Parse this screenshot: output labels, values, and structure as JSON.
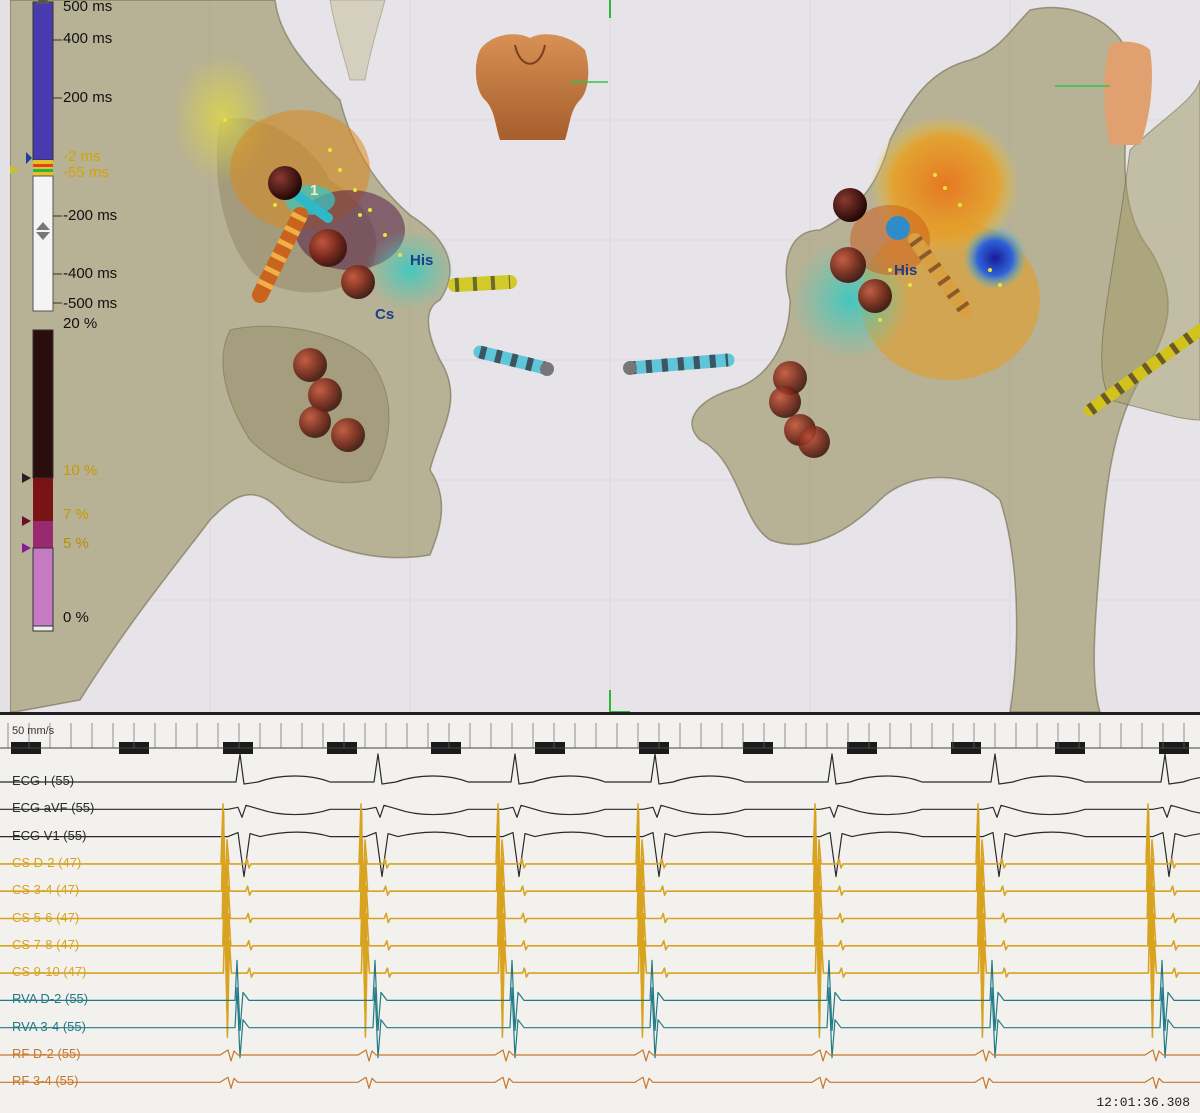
{
  "legend": {
    "lat_labels": [
      "500 ms",
      "400 ms",
      "200 ms",
      "-2 ms",
      "-55 ms",
      "-200 ms",
      "-400 ms",
      "-500 ms"
    ],
    "pct_labels": [
      "20 %",
      "10 %",
      "7 %",
      "5 %",
      "0 %"
    ]
  },
  "map_labels": {
    "left_his": "His",
    "left_cs": "Cs",
    "left_one": "1",
    "right_his": "His"
  },
  "ecg": {
    "speed": "50 mm/s",
    "timestamp": "12:01:36.308",
    "channels": [
      {
        "label": "ECG I (55)",
        "color": "#2a2a2a"
      },
      {
        "label": "ECG aVF (55)",
        "color": "#2a2a2a"
      },
      {
        "label": "ECG V1 (55)",
        "color": "#2a2a2a"
      },
      {
        "label": "CS  D-2 (47)",
        "color": "#d8a320"
      },
      {
        "label": "CS  3-4 (47)",
        "color": "#d8a320"
      },
      {
        "label": "CS  5-6 (47)",
        "color": "#d8a320"
      },
      {
        "label": "CS  7-8 (47)",
        "color": "#d8a320"
      },
      {
        "label": "CS  9-10 (47)",
        "color": "#d8a320"
      },
      {
        "label": "RVA  D-2 (55)",
        "color": "#237a86"
      },
      {
        "label": "RVA  3-4 (55)",
        "color": "#237a86"
      },
      {
        "label": "RF  D-2 (55)",
        "color": "#c5782a"
      },
      {
        "label": "RF  3-4 (55)",
        "color": "#c5782a"
      }
    ]
  },
  "colors": {
    "ecg_black": "#2a2a2a",
    "cs_yellow": "#d8a320",
    "rva_teal": "#237a86",
    "rf_orange": "#c5782a"
  }
}
